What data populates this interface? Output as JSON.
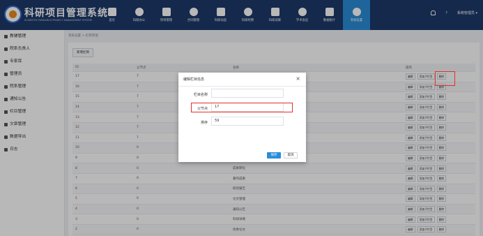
{
  "header": {
    "brand_title": "科研项目管理系统",
    "brand_subtitle": "SCIENTIFIC RESEARCH PROJECT MANAGEMENT SYSTEM",
    "nav": [
      {
        "label": "首页",
        "icon": "home-icon"
      },
      {
        "label": "科研办公",
        "icon": "office-icon"
      },
      {
        "label": "项目管理",
        "icon": "project-icon"
      },
      {
        "label": "合同管理",
        "icon": "contract-icon"
      },
      {
        "label": "科研动态",
        "icon": "news-icon"
      },
      {
        "label": "科研经费",
        "icon": "funding-icon"
      },
      {
        "label": "科研成果",
        "icon": "trophy-icon"
      },
      {
        "label": "学术会议",
        "icon": "meeting-icon"
      },
      {
        "label": "数据统计",
        "icon": "pie-chart-icon"
      },
      {
        "label": "系统设置",
        "icon": "gear-icon",
        "active": true
      }
    ],
    "help": "?",
    "user": "系统管理员 ▾"
  },
  "sidebar": {
    "items": [
      {
        "label": "教辅管理"
      },
      {
        "label": "院系负责人"
      },
      {
        "label": "专家库"
      },
      {
        "label": "管理员"
      },
      {
        "label": "院系管理"
      },
      {
        "label": "通知公告"
      },
      {
        "label": "栏目管理"
      },
      {
        "label": "文章管理"
      },
      {
        "label": "数据导出"
      },
      {
        "label": "日志"
      }
    ]
  },
  "main": {
    "breadcrumb": "系统设置 > 栏目管理",
    "add_button": "新增栏目",
    "table": {
      "headers": [
        "ID",
        "父节点",
        "名称",
        "操作"
      ],
      "ops": {
        "edit": "编辑",
        "add_child": "添加子栏目",
        "delete": "删除"
      },
      "rows": [
        {
          "id": "17",
          "parent": "7",
          "name": ""
        },
        {
          "id": "16",
          "parent": "7",
          "name": ""
        },
        {
          "id": "15",
          "parent": "7",
          "name": ""
        },
        {
          "id": "14",
          "parent": "7",
          "name": ""
        },
        {
          "id": "13",
          "parent": "7",
          "name": ""
        },
        {
          "id": "12",
          "parent": "7",
          "name": ""
        },
        {
          "id": "11",
          "parent": "7",
          "name": ""
        },
        {
          "id": "10",
          "parent": "0",
          "name": ""
        },
        {
          "id": "9",
          "parent": "0",
          "name": ""
        },
        {
          "id": "8",
          "parent": "0",
          "name": "成果转化"
        },
        {
          "id": "7",
          "parent": "0",
          "name": "著作成果"
        },
        {
          "id": "6",
          "parent": "0",
          "name": "研究报告"
        },
        {
          "id": "5",
          "parent": "0",
          "name": "论文管理"
        },
        {
          "id": "4",
          "parent": "0",
          "name": "通知公告"
        },
        {
          "id": "3",
          "parent": "0",
          "name": "科研详情"
        },
        {
          "id": "2",
          "parent": "0",
          "name": "优秀论文"
        }
      ]
    }
  },
  "modal": {
    "title": "编辑栏目信息",
    "close": "×",
    "fields": {
      "name_label": "栏目名称",
      "name_value": "",
      "parent_label": "父节点",
      "parent_value": "17",
      "order_label": "排序",
      "order_value": "59"
    },
    "save": "保存",
    "cancel": "取消"
  },
  "colors": {
    "header_bg": "#1d3a6a",
    "accent": "#2a8dd8",
    "highlight": "#e0302a"
  }
}
